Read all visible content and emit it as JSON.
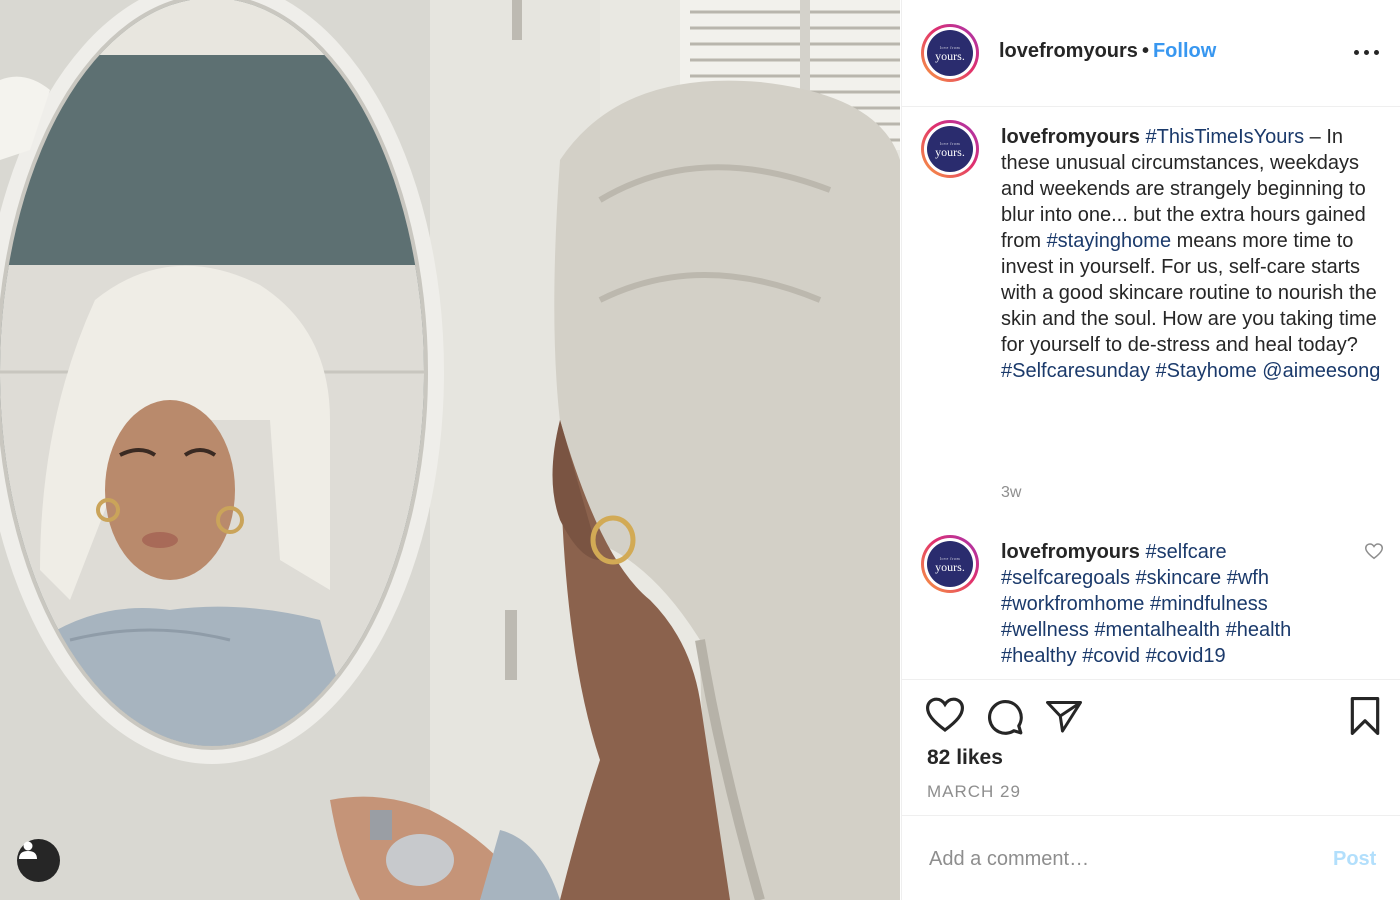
{
  "photo": {
    "description_icon": "user-tag-icon"
  },
  "header": {
    "username": "lovefromyours",
    "separator": "•",
    "follow_label": "Follow",
    "avatar_logo_small": "love from",
    "avatar_logo_text": "yours.",
    "more_icon": "more-options-icon"
  },
  "caption": {
    "username": "lovefromyours",
    "segments": [
      {
        "type": "link",
        "text": "#ThisTimeIsYours"
      },
      {
        "type": "text",
        "text": " – In these unusual circumstances, weekdays and weekends are strangely beginning to blur into one... but the extra hours gained from "
      },
      {
        "type": "link",
        "text": "#stayinghome"
      },
      {
        "type": "text",
        "text": " means more time to invest in yourself. For us, self-care starts with a good skincare routine to nourish the skin and the soul. How are you taking time for yourself to de-stress and heal today? "
      },
      {
        "type": "link",
        "text": "#Selfcaresunday"
      },
      {
        "type": "text",
        "text": " "
      },
      {
        "type": "link",
        "text": "#Stayhome"
      },
      {
        "type": "text",
        "text": " "
      },
      {
        "type": "link",
        "text": "@aimeesong"
      }
    ],
    "time": "3w"
  },
  "comment": {
    "username": "lovefromyours",
    "segments": [
      {
        "type": "link",
        "text": "#selfcare"
      },
      {
        "type": "text",
        "text": " "
      },
      {
        "type": "link",
        "text": "#selfcaregoals"
      },
      {
        "type": "text",
        "text": " "
      },
      {
        "type": "link",
        "text": "#skincare"
      },
      {
        "type": "text",
        "text": " "
      },
      {
        "type": "link",
        "text": "#wfh"
      },
      {
        "type": "text",
        "text": " "
      },
      {
        "type": "link",
        "text": "#workfromhome"
      },
      {
        "type": "text",
        "text": " "
      },
      {
        "type": "link",
        "text": "#mindfulness"
      },
      {
        "type": "text",
        "text": " "
      },
      {
        "type": "link",
        "text": "#wellness"
      },
      {
        "type": "text",
        "text": " "
      },
      {
        "type": "link",
        "text": "#mentalhealth"
      },
      {
        "type": "text",
        "text": " "
      },
      {
        "type": "link",
        "text": "#health"
      },
      {
        "type": "text",
        "text": " "
      },
      {
        "type": "link",
        "text": "#healthy"
      },
      {
        "type": "text",
        "text": " "
      },
      {
        "type": "link",
        "text": "#covid"
      },
      {
        "type": "text",
        "text": " "
      },
      {
        "type": "link",
        "text": "#covid19"
      }
    ]
  },
  "actions": {
    "like_icon": "heart-icon",
    "comment_icon": "comment-bubble-icon",
    "share_icon": "paper-plane-icon",
    "save_icon": "bookmark-icon"
  },
  "stats": {
    "likes": "82 likes",
    "date": "MARCH 29"
  },
  "add_comment": {
    "placeholder": "Add a comment…",
    "post_label": "Post"
  },
  "colors": {
    "follow": "#3897f0",
    "link": "#1b3a6b",
    "post_disabled": "#b2dffc",
    "muted": "#8e8e8e"
  }
}
